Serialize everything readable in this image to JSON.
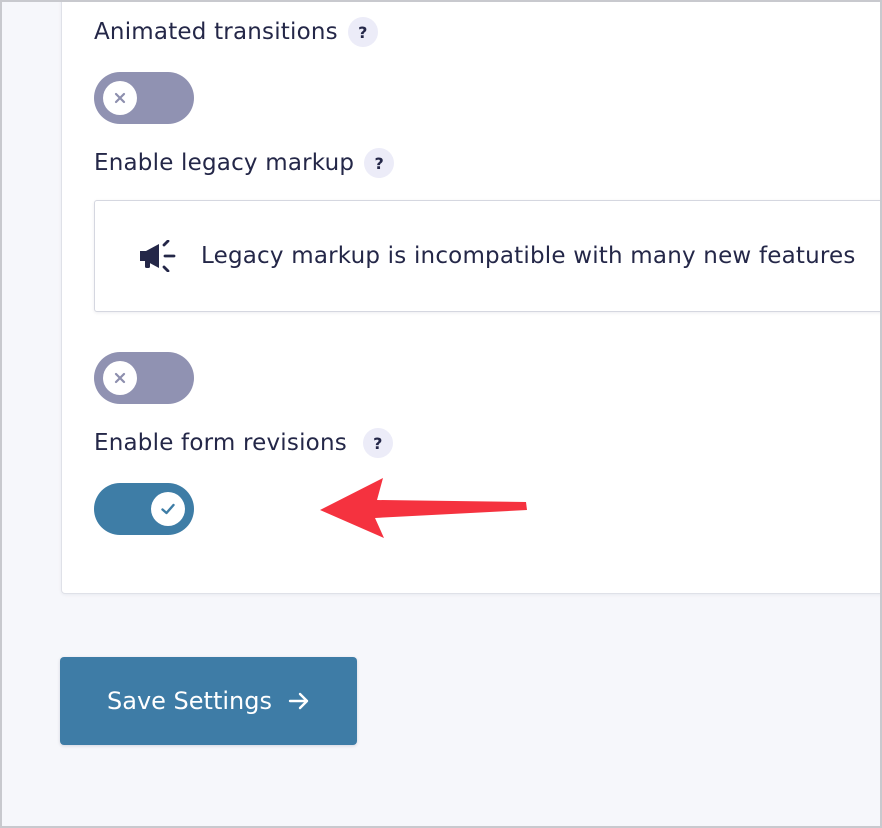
{
  "settings": {
    "animated_transitions": {
      "label": "Animated transitions",
      "help": "?",
      "enabled": false
    },
    "legacy_markup": {
      "label": "Enable legacy markup",
      "help": "?",
      "notice_icon": "megaphone-icon",
      "notice_text": "Legacy markup is incompatible with many new features",
      "enabled": false
    },
    "form_revisions": {
      "label": "Enable form revisions",
      "help": "?",
      "enabled": true
    }
  },
  "save_button": {
    "label": "Save Settings",
    "icon": "arrow-right-icon"
  },
  "colors": {
    "toggle_off": "#9092b2",
    "toggle_on": "#3e7da6",
    "button": "#3e7ca6",
    "annotation_arrow": "#f5323f",
    "text": "#242748"
  }
}
